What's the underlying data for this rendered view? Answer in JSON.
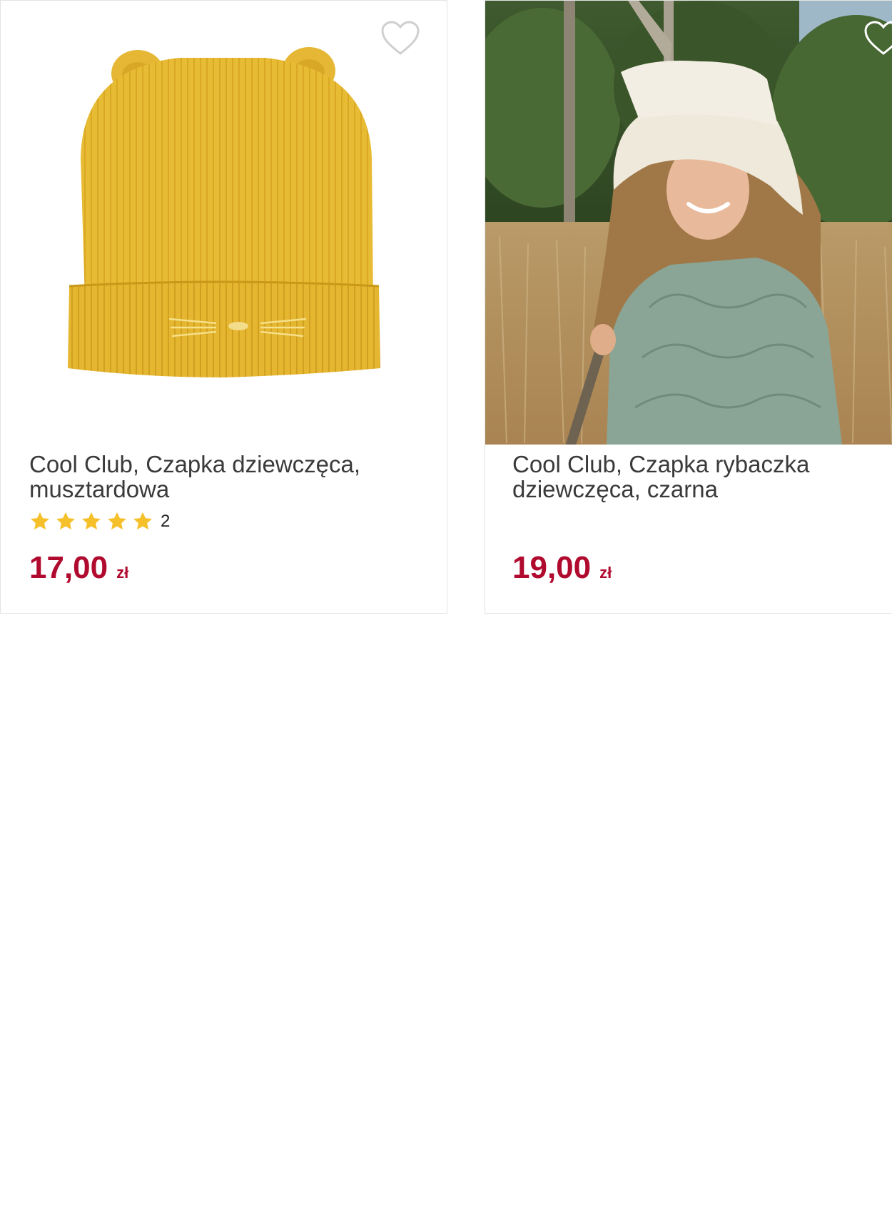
{
  "products": [
    {
      "title": "Cool Club, Czapka dziewczęca, musztardowa",
      "image": "mustard knit beanie with ears and embroidered cat whiskers",
      "rating_stars": 5,
      "rating_count": "2",
      "price": "17,00",
      "currency": "zł",
      "favorite_icon": "heart-outline-icon"
    },
    {
      "title": "Cool Club, Czapka rybaczka dziewczęca, czarna",
      "image": "girl wearing cream sherpa bucket hat and green quilted jacket in a meadow",
      "price": "19,00",
      "currency": "zł",
      "favorite_icon": "heart-outline-icon"
    }
  ],
  "colors": {
    "price": "#b00a2f",
    "star": "#f5c02a",
    "title": "#3a3a3a",
    "border": "#e3e3e3"
  }
}
